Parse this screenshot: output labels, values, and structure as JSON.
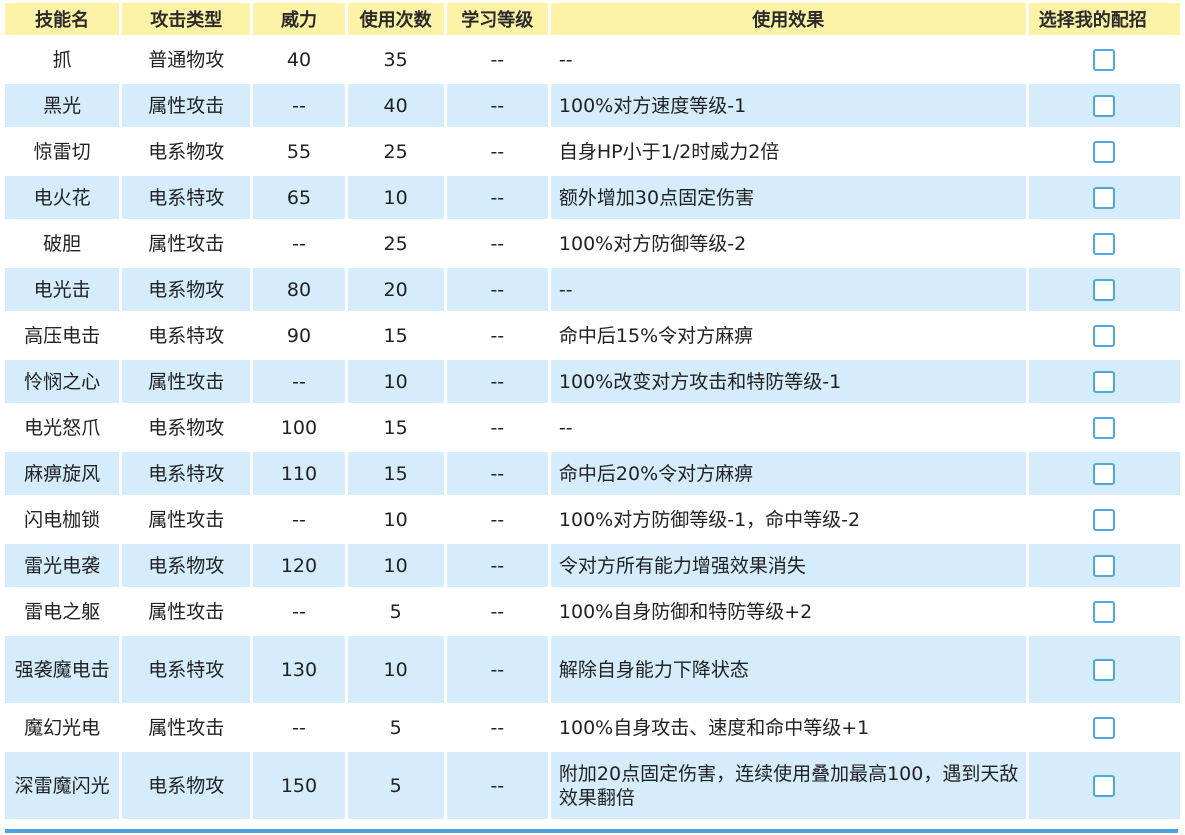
{
  "headers": [
    "技能名",
    "攻击类型",
    "威力",
    "使用次数",
    "学习等级",
    "使用效果",
    "选择我的配招"
  ],
  "rows": [
    {
      "name": "抓",
      "type": "普通物攻",
      "power": "40",
      "pp": "35",
      "level": "--",
      "effect": "--"
    },
    {
      "name": "黑光",
      "type": "属性攻击",
      "power": "--",
      "pp": "40",
      "level": "--",
      "effect": "100%对方速度等级-1"
    },
    {
      "name": "惊雷切",
      "type": "电系物攻",
      "power": "55",
      "pp": "25",
      "level": "--",
      "effect": "自身HP小于1/2时威力2倍"
    },
    {
      "name": "电火花",
      "type": "电系特攻",
      "power": "65",
      "pp": "10",
      "level": "--",
      "effect": "额外增加30点固定伤害"
    },
    {
      "name": "破胆",
      "type": "属性攻击",
      "power": "--",
      "pp": "25",
      "level": "--",
      "effect": "100%对方防御等级-2"
    },
    {
      "name": "电光击",
      "type": "电系物攻",
      "power": "80",
      "pp": "20",
      "level": "--",
      "effect": "--"
    },
    {
      "name": "高压电击",
      "type": "电系特攻",
      "power": "90",
      "pp": "15",
      "level": "--",
      "effect": "命中后15%令对方麻痹"
    },
    {
      "name": "怜悯之心",
      "type": "属性攻击",
      "power": "--",
      "pp": "10",
      "level": "--",
      "effect": "100%改变对方攻击和特防等级-1"
    },
    {
      "name": "电光怒爪",
      "type": "电系物攻",
      "power": "100",
      "pp": "15",
      "level": "--",
      "effect": "--"
    },
    {
      "name": "麻痹旋风",
      "type": "电系特攻",
      "power": "110",
      "pp": "15",
      "level": "--",
      "effect": "命中后20%令对方麻痹"
    },
    {
      "name": "闪电枷锁",
      "type": "属性攻击",
      "power": "--",
      "pp": "10",
      "level": "--",
      "effect": "100%对方防御等级-1，命中等级-2"
    },
    {
      "name": "雷光电袭",
      "type": "电系物攻",
      "power": "120",
      "pp": "10",
      "level": "--",
      "effect": "令对方所有能力增强效果消失"
    },
    {
      "name": "雷电之躯",
      "type": "属性攻击",
      "power": "--",
      "pp": "5",
      "level": "--",
      "effect": "100%自身防御和特防等级+2"
    },
    {
      "name": "强袭魔电击",
      "type": "电系特攻",
      "power": "130",
      "pp": "10",
      "level": "--",
      "effect": "解除自身能力下降状态"
    },
    {
      "name": "魔幻光电",
      "type": "属性攻击",
      "power": "--",
      "pp": "5",
      "level": "--",
      "effect": "100%自身攻击、速度和命中等级+1"
    },
    {
      "name": "深雷魔闪光",
      "type": "电系物攻",
      "power": "150",
      "pp": "5",
      "level": "--",
      "effect": "附加20点固定伤害，连续使用叠加最高100，遇到天敌效果翻倍"
    }
  ]
}
